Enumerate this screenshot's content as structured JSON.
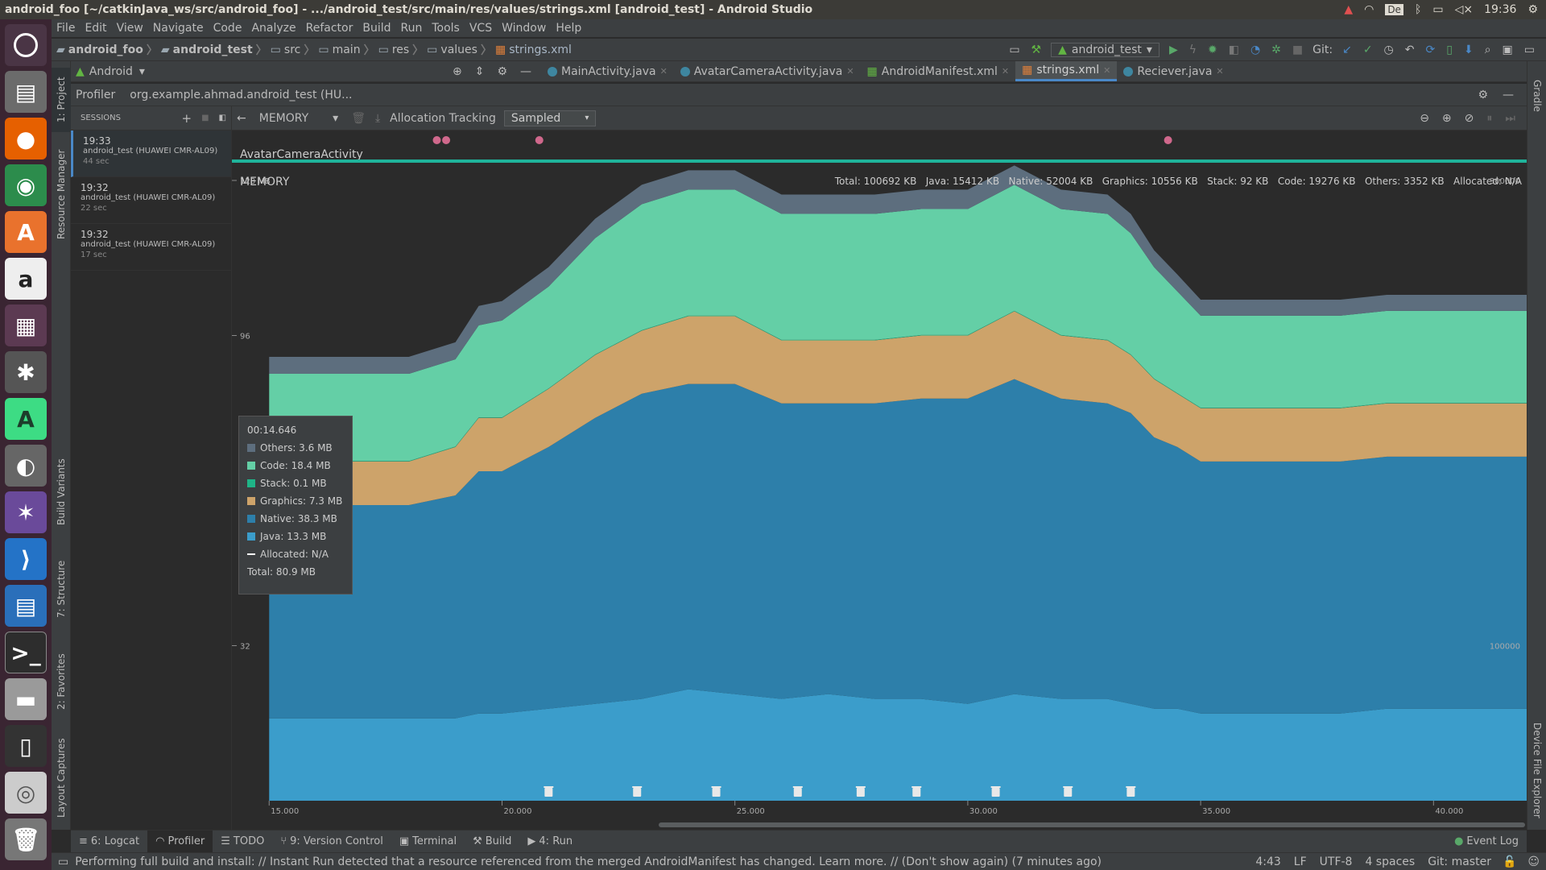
{
  "window": {
    "title": "android_foo [~/catkinJava_ws/src/android_foo] - .../android_test/src/main/res/values/strings.xml [android_test] - Android Studio"
  },
  "system": {
    "time": "19:36",
    "keyboard": "De"
  },
  "menu": [
    "File",
    "Edit",
    "View",
    "Navigate",
    "Code",
    "Analyze",
    "Refactor",
    "Build",
    "Run",
    "Tools",
    "VCS",
    "Window",
    "Help"
  ],
  "breadcrumb": [
    "android_foo",
    "android_test",
    "src",
    "main",
    "res",
    "values",
    "strings.xml"
  ],
  "toolbar": {
    "run_config": "android_test",
    "git_label": "Git:"
  },
  "project_view": {
    "label": "Android"
  },
  "editor_tabs": [
    {
      "label": "MainActivity.java",
      "active": false
    },
    {
      "label": "AvatarCameraActivity.java",
      "active": false
    },
    {
      "label": "AndroidManifest.xml",
      "active": false
    },
    {
      "label": "strings.xml",
      "active": true
    },
    {
      "label": "Reciever.java",
      "active": false
    }
  ],
  "left_tool_windows": [
    "1: Project",
    "Resource Manager",
    "Build Variants",
    "7: Structure",
    "2: Favorites",
    "Layout Captures"
  ],
  "right_tool_windows": [
    "Gradle",
    "Device File Explorer"
  ],
  "profiler": {
    "title": "Profiler",
    "process": "org.example.ahmad.android_test (HU...",
    "sessions_header": "SESSIONS",
    "sessions": [
      {
        "time": "19:33",
        "device": "android_test (HUAWEI CMR-AL09)",
        "duration": "44 sec"
      },
      {
        "time": "19:32",
        "device": "android_test (HUAWEI CMR-AL09)",
        "duration": "22 sec"
      },
      {
        "time": "19:32",
        "device": "android_test (HUAWEI CMR-AL09)",
        "duration": "17 sec"
      }
    ],
    "monitor": "MEMORY",
    "allocation_label": "Allocation Tracking",
    "allocation_mode": "Sampled",
    "activity": "AvatarCameraActivity",
    "memory_label": "MEMORY",
    "summary": "Total: 100692 KB   Java: 15412 KB   Native: 52004 KB   Graphics: 10556 KB   Stack: 92 KB   Code: 19276 KB   Others: 3352 KB   Allocated: N/A"
  },
  "chart_data": {
    "type": "area",
    "stacked": true,
    "x": [
      15.0,
      16.0,
      17.0,
      18.0,
      19.0,
      19.5,
      20.0,
      21.0,
      22.0,
      23.0,
      24.0,
      25.0,
      26.0,
      27.0,
      28.0,
      29.0,
      30.0,
      31.0,
      32.0,
      33.0,
      33.5,
      34.0,
      34.5,
      35.0,
      36.0,
      37.0,
      38.0,
      39.0,
      40.0,
      41.0,
      42.0
    ],
    "series": [
      {
        "name": "Java",
        "color": "#3b9dcb",
        "values": [
          17,
          17,
          17,
          17,
          17,
          18,
          18,
          19,
          20,
          21,
          23,
          22,
          21,
          22,
          21,
          21,
          20,
          22,
          21,
          21,
          20,
          19,
          19,
          18,
          18,
          18,
          18,
          19,
          19,
          19,
          19
        ]
      },
      {
        "name": "Native",
        "color": "#2d7faa",
        "values": [
          44,
          44,
          44,
          44,
          46,
          50,
          50,
          54,
          59,
          63,
          63,
          64,
          61,
          60,
          61,
          62,
          63,
          65,
          62,
          61,
          60,
          56,
          54,
          52,
          52,
          52,
          52,
          52,
          52,
          52,
          52
        ]
      },
      {
        "name": "Graphics",
        "color": "#cda36a",
        "values": [
          9,
          9,
          9,
          9,
          10,
          11,
          11,
          12,
          13,
          13,
          14,
          14,
          13,
          13,
          13,
          13,
          13,
          14,
          13,
          13,
          12,
          12,
          11,
          11,
          11,
          11,
          11,
          11,
          11,
          11,
          11
        ]
      },
      {
        "name": "Stack",
        "color": "#1fb487",
        "values": [
          0.1,
          0.1,
          0.1,
          0.1,
          0.1,
          0.1,
          0.1,
          0.1,
          0.1,
          0.1,
          0.1,
          0.1,
          0.1,
          0.1,
          0.1,
          0.1,
          0.1,
          0.1,
          0.1,
          0.1,
          0.1,
          0.1,
          0.1,
          0.1,
          0.1,
          0.1,
          0.1,
          0.1,
          0.1,
          0.1,
          0.1
        ]
      },
      {
        "name": "Code",
        "color": "#64cfa6",
        "values": [
          18,
          18,
          18,
          18,
          18,
          19,
          20,
          21,
          24,
          26,
          26,
          26,
          26,
          26,
          26,
          26,
          26,
          26,
          26,
          26,
          25,
          23,
          21,
          19,
          19,
          19,
          19,
          19,
          19,
          19,
          19
        ]
      },
      {
        "name": "Others",
        "color": "#5d6e7e",
        "values": [
          3.5,
          3.5,
          3.5,
          3.5,
          3.5,
          4,
          4,
          4,
          4,
          4,
          4,
          4,
          4,
          4,
          4,
          4,
          4,
          4,
          4,
          4,
          4,
          3.5,
          3.5,
          3.3,
          3.3,
          3.3,
          3.3,
          3.3,
          3.3,
          3.3,
          3.3
        ]
      }
    ],
    "x_ticks": [
      "15.000",
      "20.000",
      "25.000",
      "30.000",
      "35.000",
      "40.000"
    ],
    "y_left_ticks": [
      "128 MB",
      "96",
      "32"
    ],
    "y_right_ticks": [
      "300000",
      "100000"
    ],
    "ylim": [
      0,
      128
    ],
    "xlim": [
      14.2,
      42.0
    ],
    "gc_events": [
      21.0,
      22.9,
      24.6,
      26.35,
      27.7,
      28.9,
      30.6,
      32.15,
      33.5
    ],
    "activity_events": [
      18.6,
      18.8,
      20.8,
      34.3
    ]
  },
  "tooltip": {
    "time": "00:14.646",
    "rows": [
      {
        "label": "Others: 3.6 MB",
        "color": "#5d6e7e"
      },
      {
        "label": "Code: 18.4 MB",
        "color": "#64cfa6"
      },
      {
        "label": "Stack: 0.1 MB",
        "color": "#1fb487"
      },
      {
        "label": "Graphics: 7.3 MB",
        "color": "#cda36a"
      },
      {
        "label": "Native: 38.3 MB",
        "color": "#2d7faa"
      },
      {
        "label": "Java: 13.3 MB",
        "color": "#3b9dcb"
      },
      {
        "label": "Allocated: N/A",
        "color": "dash"
      }
    ],
    "total": "Total: 80.9 MB"
  },
  "bottom_tools": [
    {
      "label": "6: Logcat",
      "active": false
    },
    {
      "label": "Profiler",
      "active": true
    },
    {
      "label": "TODO",
      "active": false
    },
    {
      "label": "9: Version Control",
      "active": false
    },
    {
      "label": "Terminal",
      "active": false
    },
    {
      "label": "Build",
      "active": false
    },
    {
      "label": "4: Run",
      "active": false
    }
  ],
  "event_log": "Event Log",
  "status": {
    "message": "Performing full build and install: // Instant Run detected that a resource referenced from the merged AndroidManifest has changed. Learn more. // (Don't show again) (7 minutes ago)",
    "position": "4:43",
    "line_sep": "LF",
    "encoding": "UTF-8",
    "indent": "4 spaces",
    "git": "Git: master"
  }
}
